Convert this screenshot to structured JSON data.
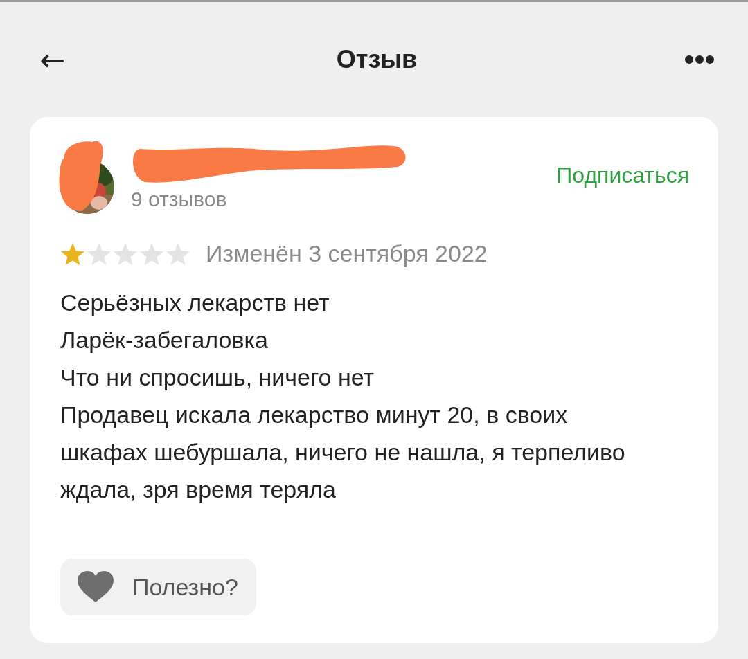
{
  "header": {
    "back_icon": "←",
    "title": "Отзыв"
  },
  "review": {
    "reviews_count": "9 отзывов",
    "subscribe": "Подписаться",
    "stars": 1,
    "date": "Изменён 3 сентября 2022",
    "lines": [
      "Серьёзных лекарств нет",
      "Ларёк-забегаловка",
      "Что ни спросишь, ничего нет",
      "Продавец искала лекарство минут 20, в своих шкафах шебуршала, ничего не нашла, я терпеливо ждала, зря время теряла"
    ],
    "helpful": "Полезно?"
  }
}
